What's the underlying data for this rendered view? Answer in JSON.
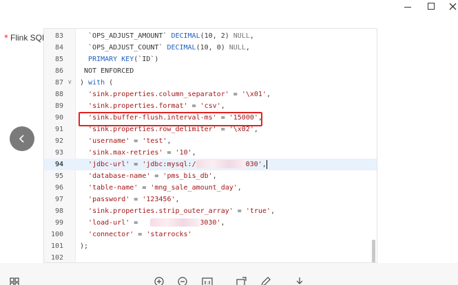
{
  "window": {
    "controls": [
      "minimize",
      "maximize",
      "close"
    ]
  },
  "form": {
    "required_mark": "*",
    "label": "Flink SQL:"
  },
  "editor": {
    "active_line": 94,
    "highlighted_line": 90,
    "lines": [
      {
        "n": "83",
        "segments": [
          [
            "  `OPS_ADJUST_AMOUNT` ",
            "plain"
          ],
          [
            "DECIMAL",
            "kw"
          ],
          [
            "(10, 2) ",
            "plain"
          ],
          [
            "NULL",
            "dim"
          ],
          [
            ",",
            "plain"
          ]
        ]
      },
      {
        "n": "84",
        "segments": [
          [
            "  `OPS_ADJUST_COUNT` ",
            "plain"
          ],
          [
            "DECIMAL",
            "kw"
          ],
          [
            "(10, 0) ",
            "plain"
          ],
          [
            "NULL",
            "dim"
          ],
          [
            ",",
            "plain"
          ]
        ]
      },
      {
        "n": "85",
        "segments": [
          [
            "  ",
            "plain"
          ],
          [
            "PRIMARY KEY",
            "kw"
          ],
          [
            "(`ID`)",
            "plain"
          ]
        ]
      },
      {
        "n": "86",
        "segments": [
          [
            " NOT ENFORCED",
            "plain"
          ]
        ]
      },
      {
        "n": "87",
        "fold": true,
        "segments": [
          [
            ") ",
            "plain"
          ],
          [
            "with",
            "kw"
          ],
          [
            " (",
            "plain"
          ]
        ]
      },
      {
        "n": "88",
        "segments": [
          [
            "  ",
            "plain"
          ],
          [
            "'sink.properties.column_separator'",
            "str"
          ],
          [
            " = ",
            "plain"
          ],
          [
            "'\\x01'",
            "str"
          ],
          [
            ",",
            "plain"
          ]
        ]
      },
      {
        "n": "89",
        "segments": [
          [
            "  ",
            "plain"
          ],
          [
            "'sink.properties.format'",
            "str"
          ],
          [
            " = ",
            "plain"
          ],
          [
            "'csv'",
            "str"
          ],
          [
            ",",
            "plain"
          ]
        ]
      },
      {
        "n": "90",
        "segments": [
          [
            "  ",
            "plain"
          ],
          [
            "'sink.buffer-flush.interval-ms'",
            "str"
          ],
          [
            " = ",
            "plain"
          ],
          [
            "'15000'",
            "str"
          ],
          [
            ",",
            "plain"
          ]
        ]
      },
      {
        "n": "91",
        "segments": [
          [
            "  ",
            "plain"
          ],
          [
            "'sink.properties.row_delimiter'",
            "str"
          ],
          [
            " = ",
            "plain"
          ],
          [
            "'\\x02'",
            "str"
          ],
          [
            ",",
            "plain"
          ]
        ]
      },
      {
        "n": "92",
        "segments": [
          [
            "  ",
            "plain"
          ],
          [
            "'username'",
            "str"
          ],
          [
            " = ",
            "plain"
          ],
          [
            "'test'",
            "str"
          ],
          [
            ",",
            "plain"
          ]
        ]
      },
      {
        "n": "93",
        "segments": [
          [
            "  ",
            "plain"
          ],
          [
            "'sink.max-retries'",
            "str"
          ],
          [
            " = ",
            "plain"
          ],
          [
            "'10'",
            "str"
          ],
          [
            ",",
            "plain"
          ]
        ]
      },
      {
        "n": "94",
        "segments": [
          [
            "  ",
            "plain"
          ],
          [
            "'jdbc-url'",
            "str"
          ],
          [
            " = ",
            "plain"
          ],
          [
            "'jdbc:mysql:/",
            "str"
          ],
          [
            "",
            "blur"
          ],
          [
            "030'",
            "str"
          ],
          [
            ",",
            "plain"
          ],
          [
            "",
            "cursor"
          ]
        ]
      },
      {
        "n": "95",
        "segments": [
          [
            "  ",
            "plain"
          ],
          [
            "'database-name'",
            "str"
          ],
          [
            " = ",
            "plain"
          ],
          [
            "'pms_bis_db'",
            "str"
          ],
          [
            ",",
            "plain"
          ]
        ]
      },
      {
        "n": "96",
        "segments": [
          [
            "  ",
            "plain"
          ],
          [
            "'table-name'",
            "str"
          ],
          [
            " = ",
            "plain"
          ],
          [
            "'mng_sale_amount_day'",
            "str"
          ],
          [
            ",",
            "plain"
          ]
        ]
      },
      {
        "n": "97",
        "segments": [
          [
            "  ",
            "plain"
          ],
          [
            "'password'",
            "str"
          ],
          [
            " = ",
            "plain"
          ],
          [
            "'123456'",
            "str"
          ],
          [
            ",",
            "plain"
          ]
        ]
      },
      {
        "n": "98",
        "segments": [
          [
            "  ",
            "plain"
          ],
          [
            "'sink.properties.strip_outer_array'",
            "str"
          ],
          [
            " = ",
            "plain"
          ],
          [
            "'true'",
            "str"
          ],
          [
            ",",
            "plain"
          ]
        ]
      },
      {
        "n": "99",
        "segments": [
          [
            "  ",
            "plain"
          ],
          [
            "'load-url'",
            "str"
          ],
          [
            " = ",
            "plain"
          ],
          [
            "  ",
            "plain"
          ],
          [
            "",
            "blur"
          ],
          [
            "3030'",
            "str"
          ],
          [
            ",",
            "plain"
          ]
        ]
      },
      {
        "n": "100",
        "segments": [
          [
            "  ",
            "plain"
          ],
          [
            "'connector'",
            "str"
          ],
          [
            " = ",
            "plain"
          ],
          [
            "'starrocks'",
            "str"
          ]
        ]
      },
      {
        "n": "101",
        "segments": [
          [
            ");",
            "plain"
          ]
        ]
      },
      {
        "n": "102",
        "segments": []
      }
    ]
  },
  "toolbar": {
    "icons": [
      "grid-icon",
      "zoom-in-icon",
      "zoom-out-icon",
      "actual-size-icon",
      "rotate-icon",
      "edit-icon",
      "download-icon"
    ]
  },
  "colors": {
    "keyword": "#1f5fbf",
    "string": "#a31515",
    "highlight_box": "#e02020",
    "active_line_bg": "#e8f2fc"
  }
}
